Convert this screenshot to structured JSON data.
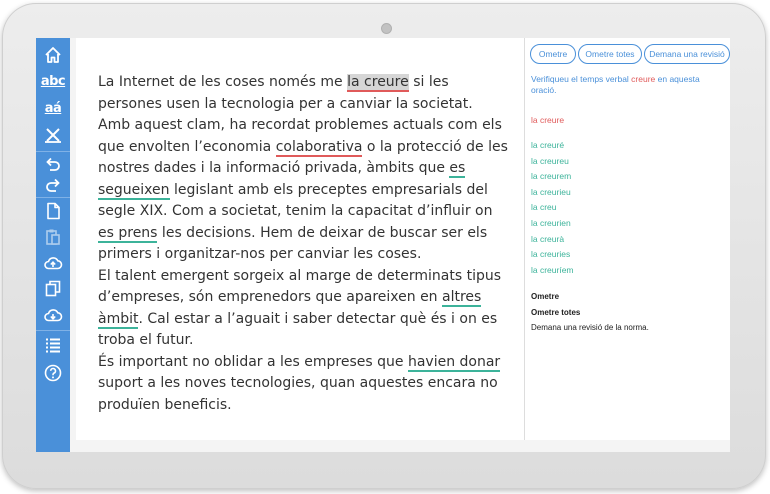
{
  "editor": {
    "paragraphs": [
      {
        "segments": [
          {
            "text": "La Internet de les coses només me "
          },
          {
            "text": "la creure",
            "mark": "selected"
          },
          {
            "text": " si les persones usen la tecnologia per a canviar la societat. Amb aquest clam, ha recordat problemes actuals com els que envolten l’economia "
          },
          {
            "text": "colaborativa",
            "mark": "red"
          },
          {
            "text": " o la protecció de les nostres dades i la informació privada, àmbits que "
          },
          {
            "text": "es segueixen",
            "mark": "green"
          },
          {
            "text": " legislant amb els preceptes empresarials del segle XIX. Com a societat, tenim la capacitat d’influir on "
          },
          {
            "text": "es prens",
            "mark": "green"
          },
          {
            "text": " les decisions. Hem de deixar de buscar ser els primers i organitzar-nos per canviar les coses."
          }
        ]
      },
      {
        "segments": [
          {
            "text": "El talent emergent sorgeix al marge de determinats tipus d’empreses, són emprenedors que apareixen en "
          },
          {
            "text": "altres àmbit",
            "mark": "green"
          },
          {
            "text": ". Cal estar a l’aguait i saber detectar què és i on es troba el futur."
          }
        ]
      },
      {
        "segments": [
          {
            "text": "És important no oblidar a les empreses que "
          },
          {
            "text": "havien donar",
            "mark": "green"
          },
          {
            "text": " suport a les noves tecnologies, quan aquestes encara no produïen beneficis."
          }
        ]
      }
    ]
  },
  "panel": {
    "buttons": [
      "Ometre",
      "Ometre totes",
      "Demana una revisió"
    ],
    "message_before": "Verifiqueu el temps verbal ",
    "message_word": "creure",
    "message_after": " en aquesta oració.",
    "wrong_phrase": "la creure",
    "suggestions": [
      "la creuré",
      "la creureu",
      "la creurem",
      "la creurieu",
      "la creu",
      "la creurien",
      "la creurà",
      "la creuries",
      "la creuríem"
    ],
    "options": {
      "omit": "Ometre",
      "omit_all": "Ometre totes",
      "review": "Demana una revisió de la norma."
    }
  },
  "colors": {
    "sidebar": "#4a90d9",
    "accent": "#4a90d9",
    "error": "#e05a5a",
    "suggestion": "#3cb39a"
  },
  "sidebar_icons": [
    "home-icon",
    "spellcheck-abc-icon",
    "accent-check-icon",
    "clear-marks-icon",
    "undo-icon",
    "redo-icon",
    "new-document-icon",
    "paste-icon",
    "upload-icon",
    "copy-icon",
    "download-icon",
    "list-icon",
    "help-icon"
  ],
  "sidebar_labels": {
    "abc": "abc",
    "accent": "aá"
  }
}
